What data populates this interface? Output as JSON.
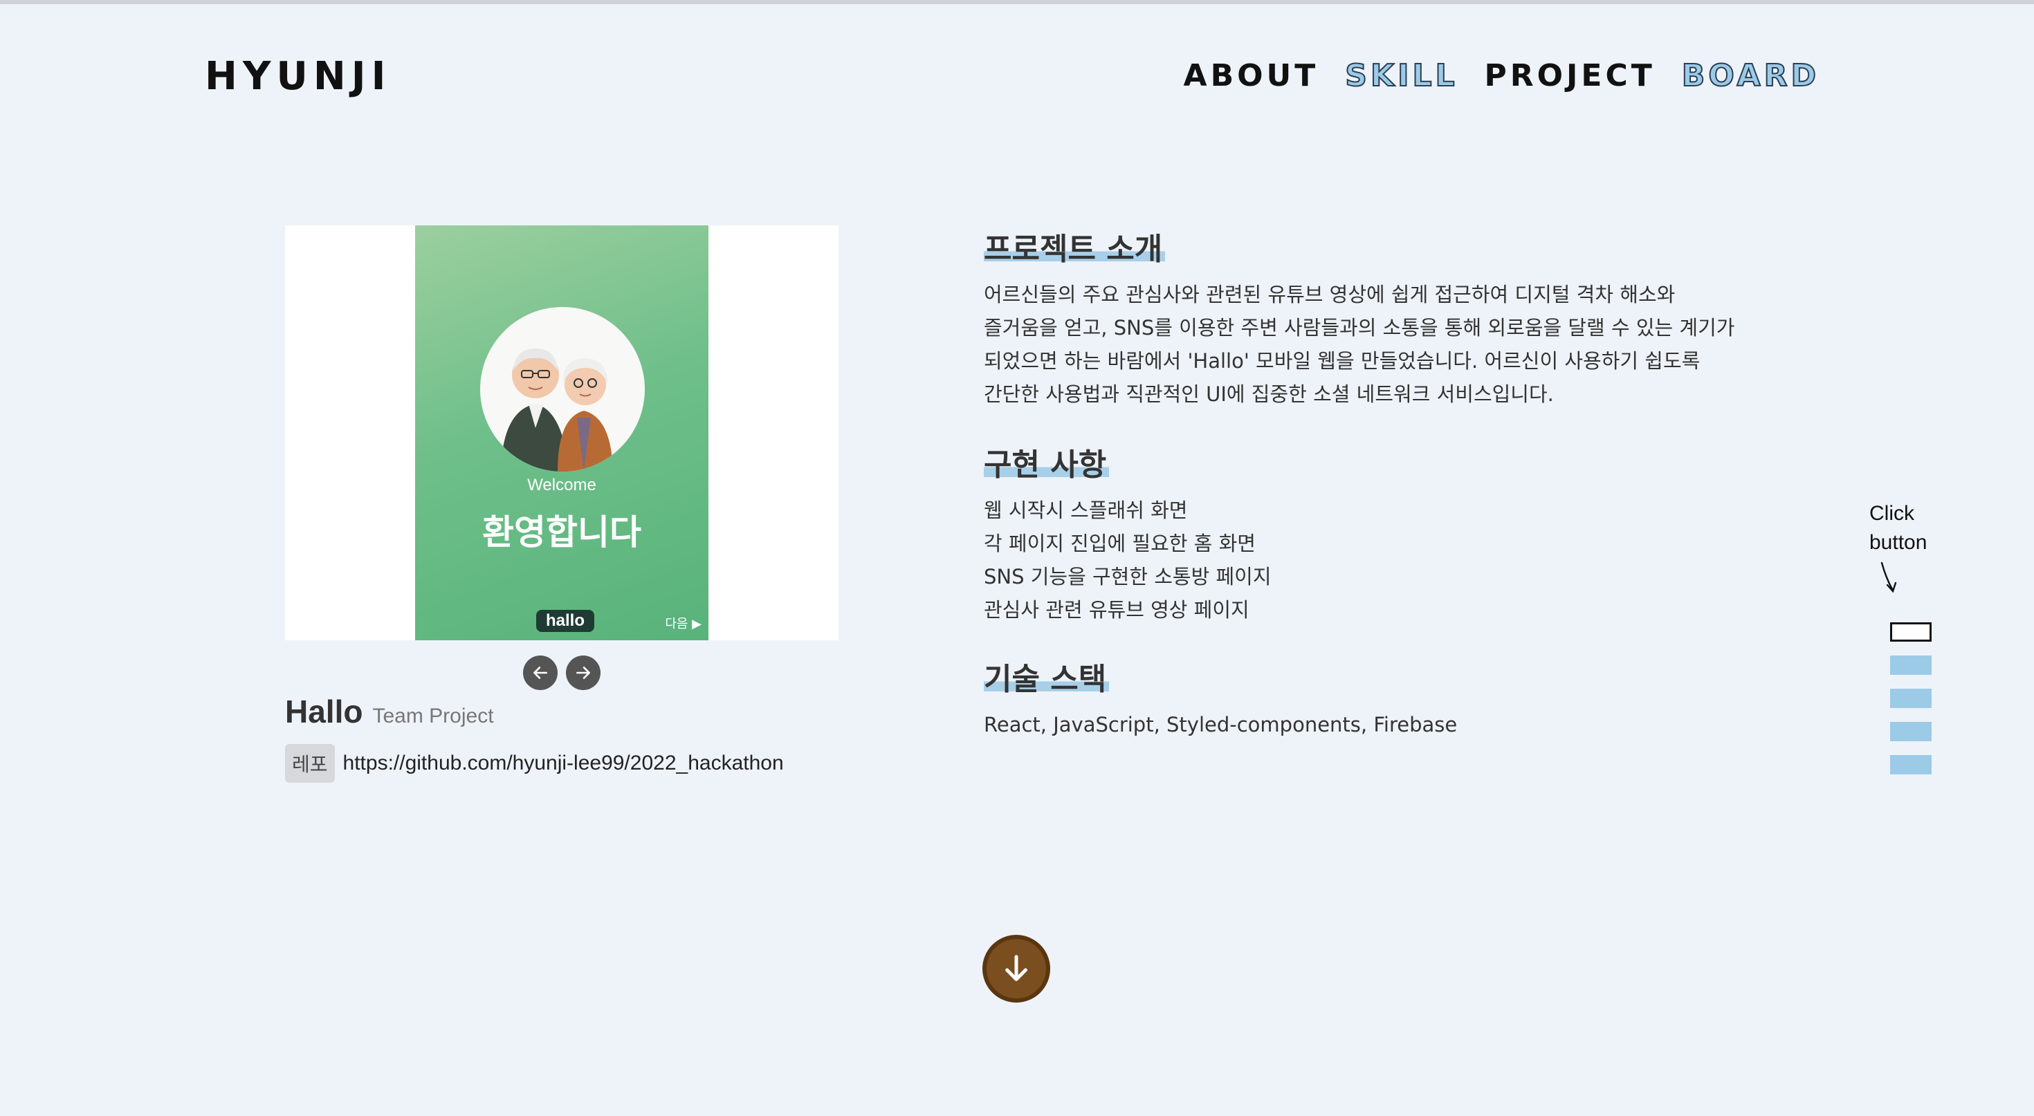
{
  "header": {
    "logo": "HYUNJI",
    "nav": [
      {
        "label": "ABOUT",
        "style": "dark"
      },
      {
        "label": "SKILL",
        "style": "blue"
      },
      {
        "label": "PROJECT",
        "style": "dark"
      },
      {
        "label": "BOARD",
        "style": "blue"
      }
    ]
  },
  "project": {
    "screenshot": {
      "welcome": "Welcome",
      "welcome_kor": "환영합니다",
      "badge": "hallo",
      "next": "다음 ▶"
    },
    "name": "Hallo",
    "type": "Team Project",
    "repo_tag": "레포",
    "repo_url": "https://github.com/hyunji-lee99/2022_hackathon"
  },
  "sections": {
    "intro": {
      "title": "프로젝트 소개",
      "lines": [
        "어르신들의 주요 관심사와 관련된 유튜브 영상에 쉽게 접근하여 디지털 격차 해소와",
        "즐거움을 얻고, SNS를 이용한 주변 사람들과의 소통을 통해 외로움을 달랠 수 있는 계기가",
        "되었으면 하는 바람에서 'Hallo' 모바일 웹을 만들었습니다. 어르신이 사용하기 쉽도록",
        "간단한 사용법과 직관적인 UI에 집중한 소셜 네트워크 서비스입니다."
      ]
    },
    "features": {
      "title": "구현 사항",
      "items": [
        "웹 시작시 스플래쉬 화면",
        "각 페이지 진입에 필요한 홈 화면",
        "SNS 기능을 구현한 소통방 페이지",
        "관심사 관련 유튜브 영상 페이지"
      ]
    },
    "stack": {
      "title": "기술 스택",
      "text": "React, JavaScript, Styled-components, Firebase"
    }
  },
  "side": {
    "hint_line1": "Click",
    "hint_line2": "button",
    "indicator_count": 5,
    "active_index": 0
  },
  "colors": {
    "accent_blue": "#9ccbe8",
    "scroll_button": "#7a4e1f",
    "background": "#eef3f9"
  }
}
